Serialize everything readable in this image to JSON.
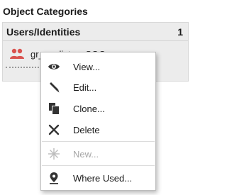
{
  "section_title": "Object Categories",
  "panel": {
    "title": "Users/Identities",
    "count": "1",
    "item": {
      "label": "gr_analistas_SOC",
      "icon": "user-group-icon",
      "icon_color": "#d9534f"
    }
  },
  "context_menu": {
    "items": [
      {
        "label": "View...",
        "icon": "eye-icon",
        "enabled": true
      },
      {
        "label": "Edit...",
        "icon": "pencil-icon",
        "enabled": true
      },
      {
        "label": "Clone...",
        "icon": "clone-icon",
        "enabled": true
      },
      {
        "label": "Delete",
        "icon": "x-icon",
        "enabled": true
      },
      {
        "label": "New...",
        "icon": "sparkle-icon",
        "enabled": false
      },
      {
        "label": "Where Used...",
        "icon": "map-pin-icon",
        "enabled": true
      }
    ]
  }
}
